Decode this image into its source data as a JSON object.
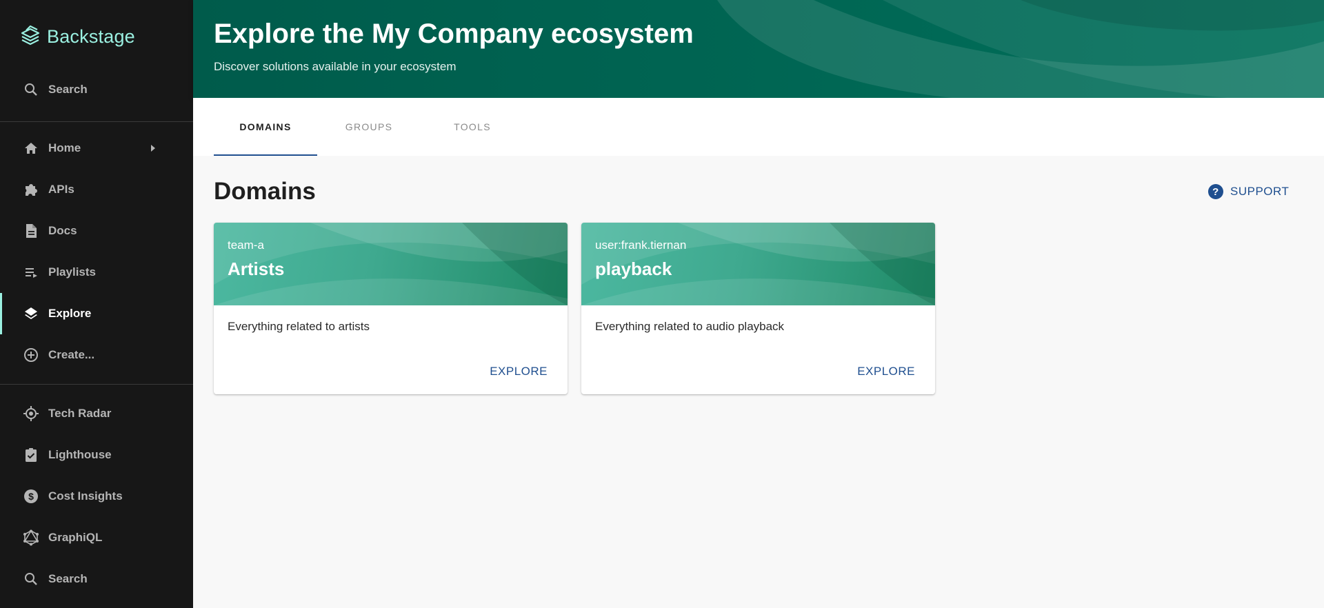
{
  "app": {
    "name": "Backstage"
  },
  "sidebar": {
    "top_search_label": "Search",
    "items": [
      {
        "label": "Home",
        "icon": "home-icon"
      },
      {
        "label": "APIs",
        "icon": "puzzle-icon"
      },
      {
        "label": "Docs",
        "icon": "document-icon"
      },
      {
        "label": "Playlists",
        "icon": "playlist-icon"
      },
      {
        "label": "Explore",
        "icon": "layers-icon",
        "active": true
      },
      {
        "label": "Create...",
        "icon": "add-circle-icon"
      }
    ],
    "plugins": [
      {
        "label": "Tech Radar",
        "icon": "radar-icon"
      },
      {
        "label": "Lighthouse",
        "icon": "clipboard-check-icon"
      },
      {
        "label": "Cost Insights",
        "icon": "dollar-icon"
      },
      {
        "label": "GraphiQL",
        "icon": "graphql-icon"
      },
      {
        "label": "Search",
        "icon": "search-icon"
      }
    ]
  },
  "header": {
    "title": "Explore the My Company ecosystem",
    "subtitle": "Discover solutions available in your ecosystem"
  },
  "tabs": [
    {
      "label": "DOMAINS",
      "active": true
    },
    {
      "label": "GROUPS",
      "active": false
    },
    {
      "label": "TOOLS",
      "active": false
    }
  ],
  "main": {
    "section_title": "Domains",
    "support_label": "SUPPORT"
  },
  "cards": [
    {
      "owner": "team-a",
      "title": "Artists",
      "description": "Everything related to artists",
      "action": "EXPLORE"
    },
    {
      "owner": "user:frank.tiernan",
      "title": "playback",
      "description": "Everything related to audio playback",
      "action": "EXPLORE"
    }
  ],
  "colors": {
    "sidebar_bg": "#171717",
    "accent": "#9bf0e1",
    "header_bg": "#00705b",
    "link": "#1f4f8f"
  }
}
